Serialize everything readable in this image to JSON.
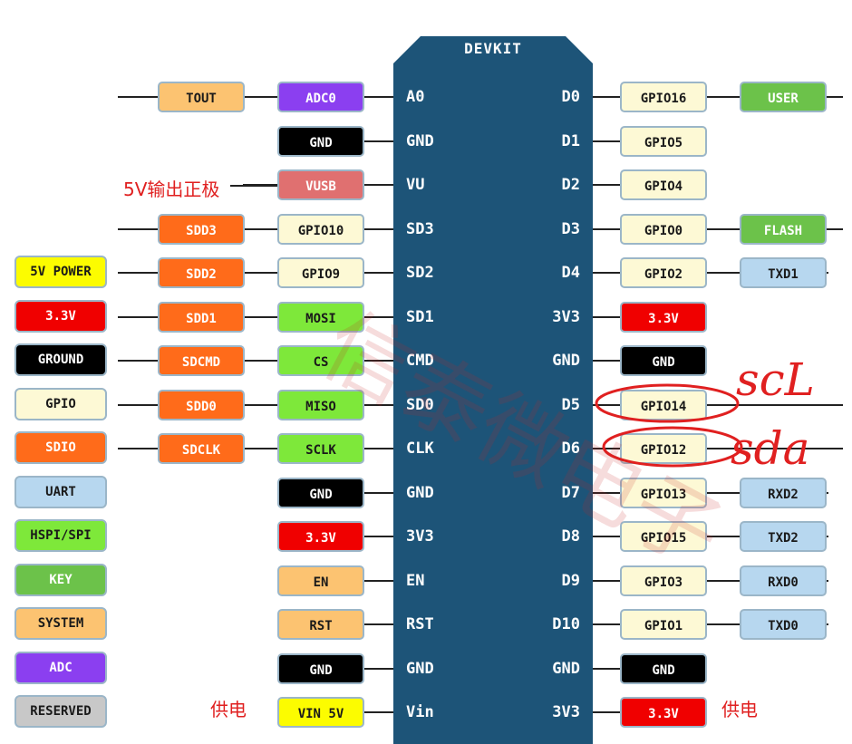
{
  "board_title": "DEVKIT",
  "colors": {
    "system": "#fcc371",
    "adc": "#8b3ff0",
    "gpio": "#fdf9d5",
    "ground": "#000000",
    "usb": "#e07070",
    "sdio": "#ff6b1a",
    "spi": "#7ee83a",
    "power33": "#f00000",
    "power5": "#fcfc00",
    "user": "#6cc24a",
    "uart": "#b7d7ef",
    "reserved": "#c8c8c8",
    "board": "#1d5478",
    "annotation": "#e02020"
  },
  "rows": [
    {
      "lpin": "A0",
      "rpin": "D0",
      "left": [
        {
          "text": "TOUT",
          "type": "system"
        },
        {
          "text": "ADC0",
          "type": "adc"
        }
      ],
      "right": [
        {
          "text": "GPIO16",
          "type": "gpio"
        },
        {
          "text": "USER",
          "type": "user"
        }
      ]
    },
    {
      "lpin": "GND",
      "rpin": "D1",
      "left": [
        {
          "text": "GND",
          "type": "ground"
        }
      ],
      "right": [
        {
          "text": "GPIO5",
          "type": "gpio"
        }
      ]
    },
    {
      "lpin": "VU",
      "rpin": "D2",
      "left": [
        {
          "text": "VUSB",
          "type": "usb"
        }
      ],
      "right": [
        {
          "text": "GPIO4",
          "type": "gpio"
        }
      ]
    },
    {
      "lpin": "SD3",
      "rpin": "D3",
      "left": [
        {
          "text": "SDD3",
          "type": "sdio"
        },
        {
          "text": "GPIO10",
          "type": "gpio"
        }
      ],
      "right": [
        {
          "text": "GPIO0",
          "type": "gpio"
        },
        {
          "text": "FLASH",
          "type": "user"
        }
      ]
    },
    {
      "lpin": "SD2",
      "rpin": "D4",
      "left": [
        {
          "text": "SDD2",
          "type": "sdio"
        },
        {
          "text": "GPIO9",
          "type": "gpio"
        }
      ],
      "right": [
        {
          "text": "GPIO2",
          "type": "gpio"
        },
        {
          "text": "TXD1",
          "type": "uart"
        }
      ]
    },
    {
      "lpin": "SD1",
      "rpin": "3V3",
      "left": [
        {
          "text": "SDD1",
          "type": "sdio"
        },
        {
          "text": "MOSI",
          "type": "spi"
        }
      ],
      "right": [
        {
          "text": "3.3V",
          "type": "power33"
        }
      ]
    },
    {
      "lpin": "CMD",
      "rpin": "GND",
      "left": [
        {
          "text": "SDCMD",
          "type": "sdio"
        },
        {
          "text": "CS",
          "type": "spi"
        }
      ],
      "right": [
        {
          "text": "GND",
          "type": "ground"
        }
      ]
    },
    {
      "lpin": "SD0",
      "rpin": "D5",
      "left": [
        {
          "text": "SDD0",
          "type": "sdio"
        },
        {
          "text": "MISO",
          "type": "spi"
        }
      ],
      "right": [
        {
          "text": "GPIO14",
          "type": "gpio"
        }
      ]
    },
    {
      "lpin": "CLK",
      "rpin": "D6",
      "left": [
        {
          "text": "SDCLK",
          "type": "sdio"
        },
        {
          "text": "SCLK",
          "type": "spi"
        }
      ],
      "right": [
        {
          "text": "GPIO12",
          "type": "gpio"
        }
      ]
    },
    {
      "lpin": "GND",
      "rpin": "D7",
      "left": [
        {
          "text": "GND",
          "type": "ground"
        }
      ],
      "right": [
        {
          "text": "GPIO13",
          "type": "gpio"
        },
        {
          "text": "RXD2",
          "type": "uart"
        }
      ]
    },
    {
      "lpin": "3V3",
      "rpin": "D8",
      "left": [
        {
          "text": "3.3V",
          "type": "power33"
        }
      ],
      "right": [
        {
          "text": "GPIO15",
          "type": "gpio"
        },
        {
          "text": "TXD2",
          "type": "uart"
        }
      ]
    },
    {
      "lpin": "EN",
      "rpin": "D9",
      "left": [
        {
          "text": "EN",
          "type": "system"
        }
      ],
      "right": [
        {
          "text": "GPIO3",
          "type": "gpio"
        },
        {
          "text": "RXD0",
          "type": "uart"
        }
      ]
    },
    {
      "lpin": "RST",
      "rpin": "D10",
      "left": [
        {
          "text": "RST",
          "type": "system"
        }
      ],
      "right": [
        {
          "text": "GPIO1",
          "type": "gpio"
        },
        {
          "text": "TXD0",
          "type": "uart"
        }
      ]
    },
    {
      "lpin": "GND",
      "rpin": "GND",
      "left": [
        {
          "text": "GND",
          "type": "ground"
        }
      ],
      "right": [
        {
          "text": "GND",
          "type": "ground"
        }
      ]
    },
    {
      "lpin": "Vin",
      "rpin": "3V3",
      "left": [
        {
          "text": "VIN 5V",
          "type": "power5"
        }
      ],
      "right": [
        {
          "text": "3.3V",
          "type": "power33"
        }
      ]
    }
  ],
  "legend": [
    {
      "text": "5V POWER",
      "type": "power5"
    },
    {
      "text": "3.3V",
      "type": "power33"
    },
    {
      "text": "GROUND",
      "type": "ground"
    },
    {
      "text": "GPIO",
      "type": "gpio"
    },
    {
      "text": "SDIO",
      "type": "sdio"
    },
    {
      "text": "UART",
      "type": "uart"
    },
    {
      "text": "HSPI/SPI",
      "type": "spi"
    },
    {
      "text": "KEY",
      "type": "user"
    },
    {
      "text": "SYSTEM",
      "type": "system"
    },
    {
      "text": "ADC",
      "type": "adc"
    },
    {
      "text": "RESERVED",
      "type": "reserved"
    }
  ],
  "notes": {
    "vusb": "5V输出正极",
    "power_left": "供电",
    "power_right": "供电",
    "scl": "scL",
    "sda": "sda"
  },
  "watermark": "信泰微电子"
}
